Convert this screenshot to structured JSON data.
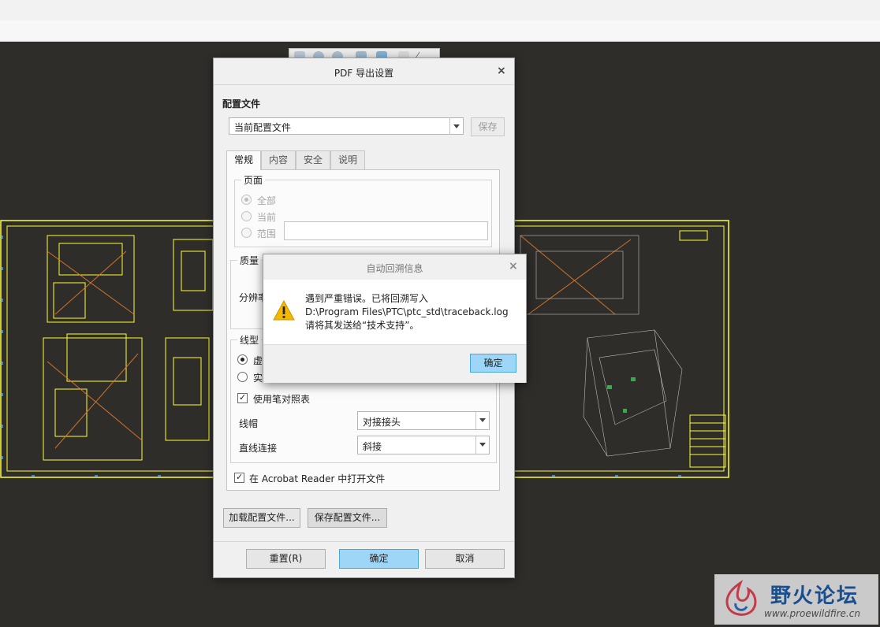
{
  "pdf_dialog": {
    "title": "PDF 导出设置",
    "close_glyph": "×",
    "profile_label": "配置文件",
    "profile_value": "当前配置文件",
    "save_button": "保存",
    "tabs": [
      "常规",
      "内容",
      "安全",
      "说明"
    ],
    "pages": {
      "legend": "页面",
      "options": [
        "全部",
        "当前",
        "范围"
      ],
      "selected": "全部",
      "range_value": ""
    },
    "quality": {
      "legend": "质量",
      "resolution_label": "分辨率"
    },
    "linetype": {
      "legend": "线型",
      "options": [
        "虚",
        "实"
      ],
      "selected": "虚"
    },
    "use_pen_table": {
      "label": "使用笔对照表",
      "checked": true
    },
    "line_cap": {
      "label": "线帽",
      "value": "对接接头"
    },
    "line_join": {
      "label": "直线连接",
      "value": "斜接"
    },
    "open_in_reader": {
      "label": "在 Acrobat Reader 中打开文件",
      "checked": true
    },
    "load_profile_button": "加载配置文件...",
    "save_profile_button": "保存配置文件...",
    "reset_button": "重置(R)",
    "ok_button": "确定",
    "cancel_button": "取消"
  },
  "error_popup": {
    "title": "自动回溯信息",
    "close_glyph": "×",
    "message_lines": [
      "遇到严重错误。已将回溯写入",
      "D:\\Program Files\\PTC\\ptc_std\\traceback.log",
      "请将其发送给“技术支持”。"
    ],
    "ok_button": "确定",
    "icon": "warning-triangle-icon"
  },
  "watermark": {
    "brand": "野火论坛",
    "url": "www.proewildfire.cn"
  },
  "colors": {
    "canvas_background": "#2f2d2a",
    "drawing_border": "#ffff33",
    "primary_button": "#9ed6f7",
    "warning_yellow": "#f5b800"
  }
}
